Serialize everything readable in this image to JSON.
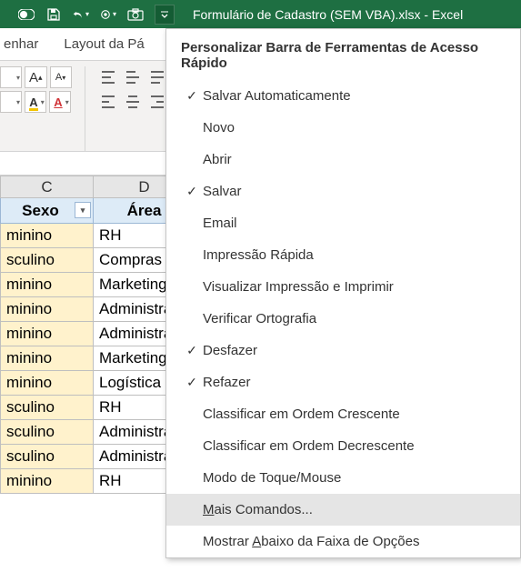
{
  "titlebar": {
    "file_title": "Formulário de Cadastro (SEM VBA).xlsx",
    "app_suffix": "  -  Excel"
  },
  "tabs": {
    "t1_partial": "enhar",
    "t2": "Layout da Pá"
  },
  "menu": {
    "title": "Personalizar Barra de Ferramentas de Acesso Rápido",
    "items": [
      {
        "label": "Salvar Automaticamente",
        "checked": true
      },
      {
        "label": "Novo",
        "checked": false
      },
      {
        "label": "Abrir",
        "checked": false
      },
      {
        "label": "Salvar",
        "checked": true
      },
      {
        "label": "Email",
        "checked": false
      },
      {
        "label": "Impressão Rápida",
        "checked": false
      },
      {
        "label": "Visualizar Impressão e Imprimir",
        "checked": false
      },
      {
        "label": "Verificar Ortografia",
        "checked": false
      },
      {
        "label": "Desfazer",
        "checked": true
      },
      {
        "label": "Refazer",
        "checked": true
      },
      {
        "label": "Classificar em Ordem Crescente",
        "checked": false
      },
      {
        "label": "Classificar em Ordem Decrescente",
        "checked": false
      },
      {
        "label": "Modo de Toque/Mouse",
        "checked": false
      }
    ],
    "more_prefix": "M",
    "more_rest": "ais Comandos...",
    "show_below_prefix": "Mostrar ",
    "show_below_mn": "A",
    "show_below_rest": "baixo da Faixa de Opções"
  },
  "columns": {
    "c": "C",
    "d": "D",
    "h_sexo": "Sexo",
    "h_area": "Área"
  },
  "rows": [
    {
      "sexo": "minino",
      "area": "RH"
    },
    {
      "sexo": "sculino",
      "area": "Compras"
    },
    {
      "sexo": "minino",
      "area": "Marketing"
    },
    {
      "sexo": "minino",
      "area": "Administrat"
    },
    {
      "sexo": "minino",
      "area": "Administrat"
    },
    {
      "sexo": "minino",
      "area": "Marketing"
    },
    {
      "sexo": "minino",
      "area": "Logística"
    },
    {
      "sexo": "sculino",
      "area": "RH"
    },
    {
      "sexo": "sculino",
      "area": "Administrat"
    },
    {
      "sexo": "sculino",
      "area": "Administrat"
    },
    {
      "sexo": "minino",
      "area": "RH"
    }
  ],
  "ribbon": {
    "grow": "A",
    "shrink": "A",
    "fill_letter": "A",
    "font_color_letter": "A"
  }
}
